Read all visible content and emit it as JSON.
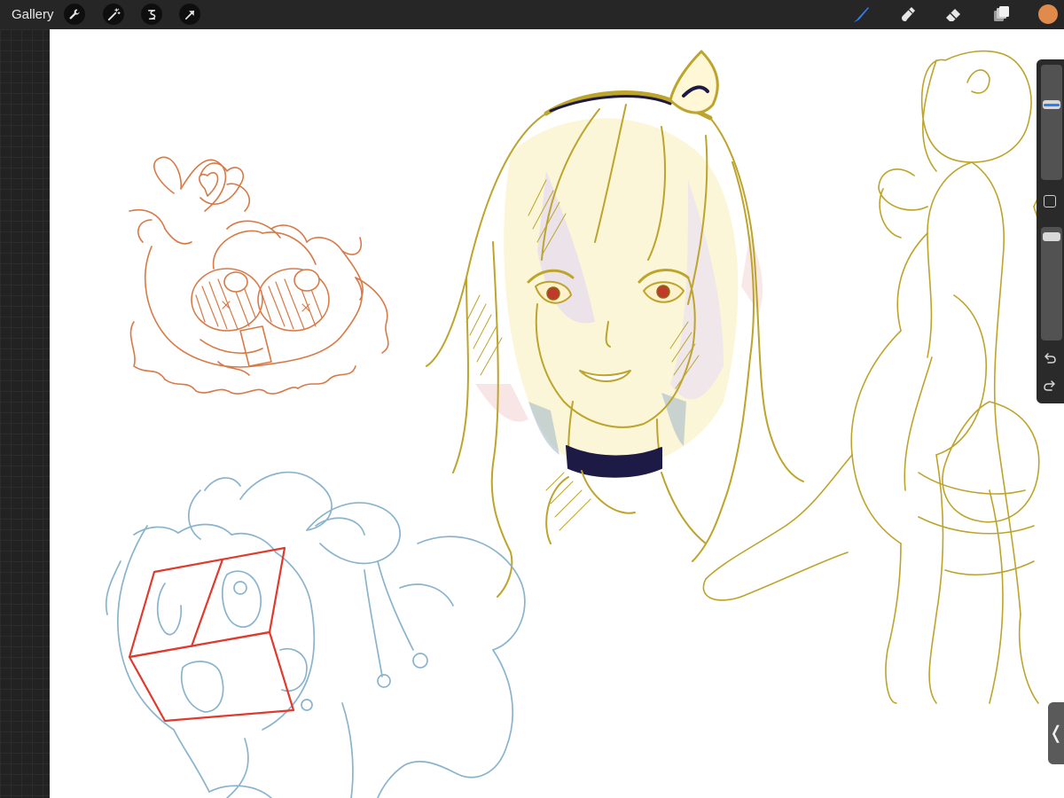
{
  "toolbar": {
    "gallery_label": "Gallery",
    "left_tools": [
      "wrench-icon",
      "magic-wand-icon",
      "selection-icon",
      "transform-arrow-icon"
    ],
    "right_tools": [
      "brush-icon",
      "smudge-icon",
      "eraser-icon",
      "layers-icon"
    ],
    "current_color": "#e08a4c",
    "active_tool_color": "#2f7bf0"
  },
  "sidebar": {
    "brush_size_level": 0.33,
    "opacity_level": 0.05
  },
  "handle": {
    "label": "❬"
  },
  "colors": {
    "orange_sketch": "#d77a48",
    "gold_sketch": "#bda42c",
    "blue_sketch": "#8ab4cd",
    "red_boxes": "#e03a2e",
    "navy_ink": "#1d1b45"
  }
}
